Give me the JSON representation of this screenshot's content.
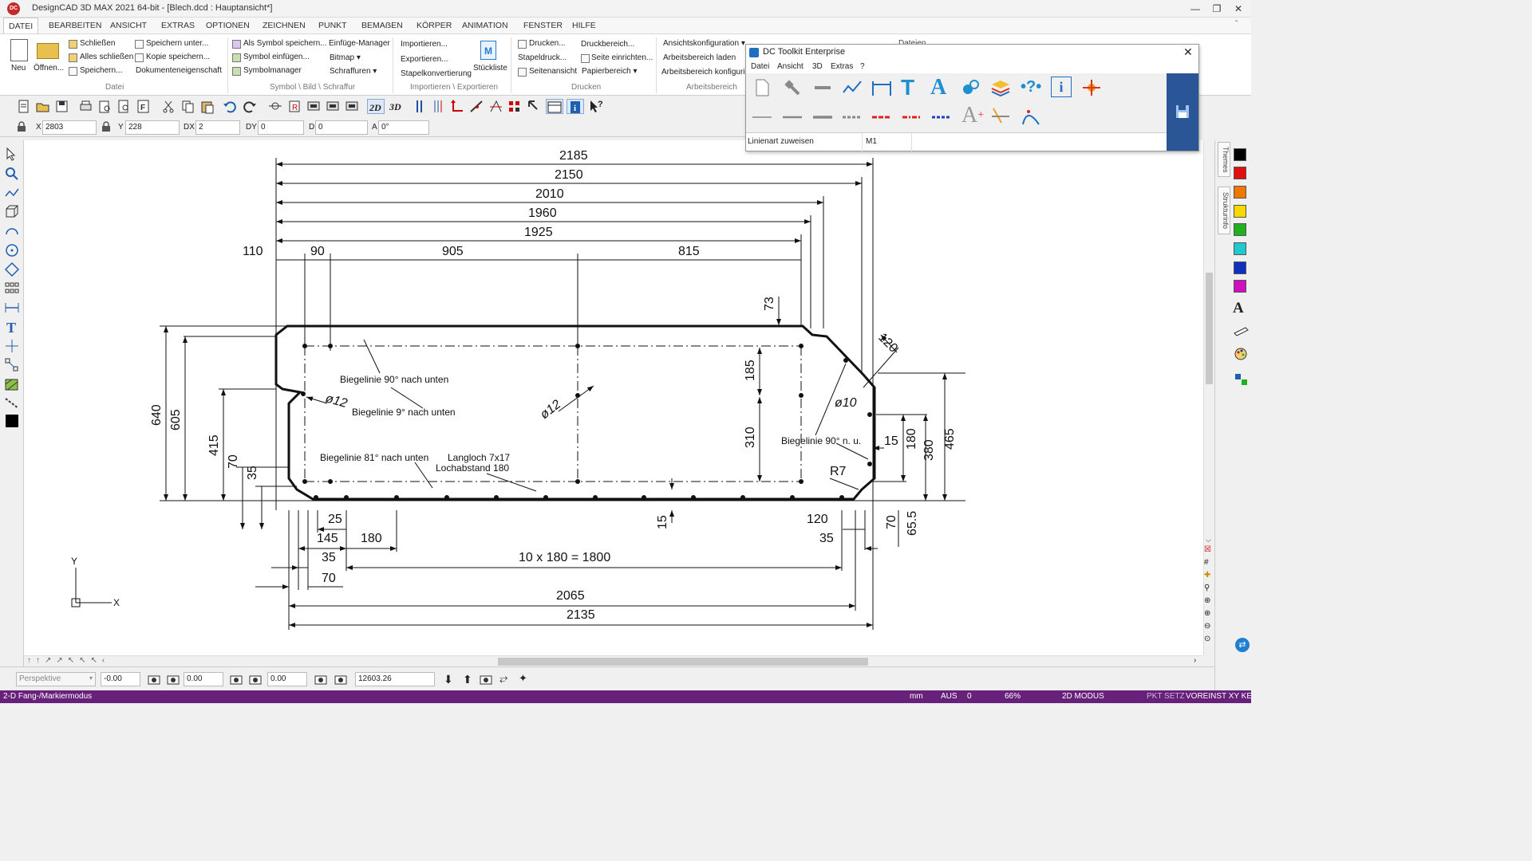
{
  "window": {
    "app_icon": "DC",
    "title": "DesignCAD 3D MAX 2021 64-bit - [Blech.dcd : Hauptansicht*]",
    "controls": [
      "minimize-icon",
      "restore-icon",
      "close-icon"
    ]
  },
  "ribbon": {
    "tabs": [
      "DATEI",
      "BEARBEITEN",
      "ANSICHT",
      "EXTRAS",
      "OPTIONEN",
      "ZEICHNEN",
      "PUNKT",
      "BEMAẞEN",
      "KÖRPER",
      "ANIMATION",
      "FENSTER",
      "HILFE"
    ],
    "active_tab": "DATEI",
    "groups": {
      "datei": {
        "name": "Datei",
        "neu": "Neu",
        "oeffnen": "Öffnen...",
        "schliessen": "Schließen",
        "alles_schliessen": "Alles schließen",
        "speichern": "Speichern...",
        "speichern_unter": "Speichern unter...",
        "kopie_speichern": "Kopie speichern...",
        "dokumenteneigenschaft": "Dokumenteneigenschaft"
      },
      "symbol": {
        "name": "Symbol \\ Bild \\ Schraffur",
        "als_symbol": "Als Symbol speichern...",
        "symbol_einfuegen": "Symbol einfügen...",
        "symbolmanager": "Symbolmanager",
        "einfuege_manager": "Einfüge-Manager",
        "bitmap": "Bitmap",
        "schraffuren": "Schraffuren"
      },
      "import": {
        "name": "Importieren \\ Exportieren",
        "importieren": "Importieren...",
        "exportieren": "Exportieren...",
        "stapelkonvertierung": "Stapelkonvertierung",
        "stueckliste": "Stückliste"
      },
      "drucken": {
        "name": "Drucken",
        "drucken": "Drucken...",
        "stapeldruck": "Stapeldruck...",
        "seitenansicht": "Seitenansicht",
        "druckbereich": "Druckbereich...",
        "seite_einrichten": "Seite einrichten...",
        "papierbereich": "Papierbereich"
      },
      "arbeitsbereich": {
        "name": "Arbeitsbereich",
        "ansichtskonfiguration": "Ansichtskonfiguration",
        "arbeitsbereich_laden": "Arbeitsbereich laden",
        "arbeitsbereich_konfig": "Arbeitsbereich konfigurieren"
      },
      "partial": "Dateien"
    }
  },
  "coords": {
    "x_label": "X",
    "x": "2803",
    "y_label": "Y",
    "y": "228",
    "dx_label": "DX",
    "dx": "2",
    "dy_label": "DY",
    "dy": "0",
    "d_label": "D",
    "d": "0",
    "a_label": "A",
    "a": "0°"
  },
  "toolkit": {
    "title": "DC Toolkit Enterprise",
    "menu": [
      "Datei",
      "Ansicht",
      "3D",
      "Extras",
      "?"
    ],
    "footer_label": "Linienart zuweisen",
    "footer_value": "M1"
  },
  "right_tabs": [
    "Themes",
    "Strukturinfo"
  ],
  "colors": {
    "swatches": [
      "#000000",
      "#e01010",
      "#f07800",
      "#f8d800",
      "#20b020",
      "#20c8d0",
      "#1030c0",
      "#d010c0"
    ],
    "status_bg": "#68217a",
    "toolkit_panel": "#2a5597"
  },
  "drawing": {
    "dims_top": [
      "2185",
      "2150",
      "2010",
      "1960",
      "1925"
    ],
    "dims_row": [
      "110",
      "90",
      "905",
      "815"
    ],
    "dims_left": [
      "640",
      "605",
      "415",
      "70",
      "35"
    ],
    "dims_right": [
      "73",
      "185",
      "310",
      "120",
      "15",
      "180",
      "380",
      "465",
      "R7"
    ],
    "dims_bottom": [
      "25",
      "145",
      "180",
      "35",
      "70",
      "120",
      "35",
      "70",
      "65.5",
      "15"
    ],
    "series_label": "10 x 180 = 1800",
    "dims_total_bottom": [
      "2065",
      "2135"
    ],
    "diameters": [
      "ø12",
      "ø12",
      "ø10"
    ],
    "notes": {
      "bl90": "Biegelinie 90° nach unten",
      "bl9": "Biegelinie 9° nach unten",
      "bl81": "Biegelinie 81° nach unten",
      "langloch": "Langloch 7x17",
      "lochabstand": "Lochabstand 180",
      "bl90nu": "Biegelinie 90° n. u."
    },
    "axis_x": "X",
    "axis_y": "Y"
  },
  "bottom": {
    "view": "Perspektive",
    "v1": "-0.00",
    "v2": "0.00",
    "v3": "0.00",
    "v4": "12603.26"
  },
  "status": {
    "mode": "2-D Fang-/Markiermodus",
    "unit": "mm",
    "aus": "AUS",
    "num": "0",
    "zoom": "66%",
    "modus": "2D MODUS",
    "pkt": "PKT SETZ",
    "voreinst": "VOREINST XY KE"
  }
}
